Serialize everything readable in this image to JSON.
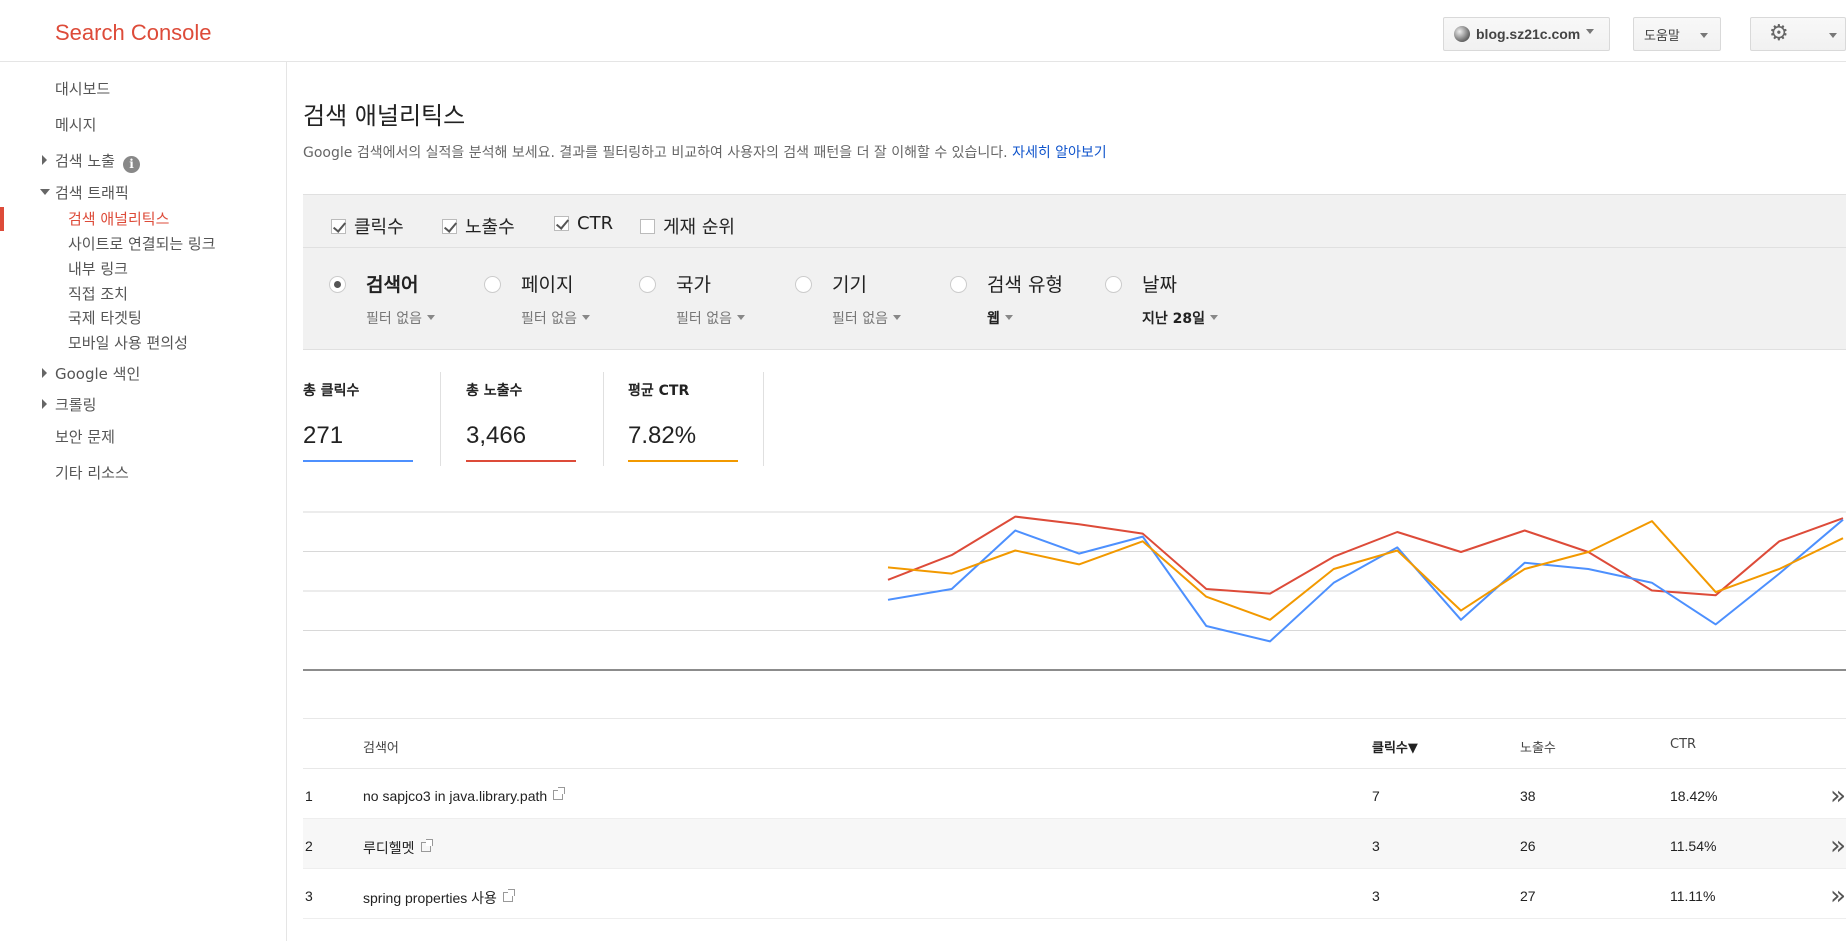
{
  "header": {
    "logo": "Search Console",
    "site": "blog.sz21c.com",
    "help": "도움말"
  },
  "sidebar": {
    "items": [
      {
        "label": "대시보드"
      },
      {
        "label": "메시지"
      },
      {
        "label": "검색 노출"
      },
      {
        "label": "검색 트래픽"
      },
      {
        "label": "Google 색인"
      },
      {
        "label": "크롤링"
      },
      {
        "label": "보안 문제"
      },
      {
        "label": "기타 리소스"
      }
    ],
    "subitems": [
      {
        "label": "검색 애널리틱스"
      },
      {
        "label": "사이트로 연결되는 링크"
      },
      {
        "label": "내부 링크"
      },
      {
        "label": "직접 조치"
      },
      {
        "label": "국제 타겟팅"
      },
      {
        "label": "모바일 사용 편의성"
      }
    ]
  },
  "page": {
    "title": "검색 애널리틱스",
    "subtitle": "Google 검색에서의 실적을 분석해 보세요. 결과를 필터링하고 비교하여 사용자의 검색 패턴을 더 잘 이해할 수 있습니다.",
    "learn_more": "자세히 알아보기"
  },
  "metrics": [
    {
      "label": "클릭수",
      "checked": true
    },
    {
      "label": "노출수",
      "checked": true
    },
    {
      "label": "CTR",
      "checked": true
    },
    {
      "label": "게재 순위",
      "checked": false
    }
  ],
  "dimensions": [
    {
      "label": "검색어",
      "filter": "필터 없음",
      "selected": true
    },
    {
      "label": "페이지",
      "filter": "필터 없음",
      "selected": false
    },
    {
      "label": "국가",
      "filter": "필터 없음",
      "selected": false
    },
    {
      "label": "기기",
      "filter": "필터 없음",
      "selected": false
    },
    {
      "label": "검색 유형",
      "filter": "웹",
      "selected": false
    },
    {
      "label": "날짜",
      "filter": "지난 28일",
      "selected": false
    }
  ],
  "totals": [
    {
      "label": "총 클릭수",
      "value": "271",
      "color": "#4d90fe"
    },
    {
      "label": "총 노출수",
      "value": "3,466",
      "color": "#dd4b39"
    },
    {
      "label": "평균 CTR",
      "value": "7.82%",
      "color": "#f29900"
    }
  ],
  "chart_data": {
    "type": "line",
    "x": [
      1,
      2,
      3,
      4,
      5,
      6,
      7,
      8,
      9,
      10,
      11,
      12,
      13,
      14,
      15
    ],
    "series": [
      {
        "color": "#dd4b39",
        "values": [
          0.56,
          0.72,
          0.97,
          0.92,
          0.86,
          0.5,
          0.47,
          0.71,
          0.87,
          0.74,
          0.88,
          0.74,
          0.49,
          0.46,
          0.81,
          0.96
        ]
      },
      {
        "color": "#4d90fe",
        "values": [
          0.43,
          0.5,
          0.88,
          0.73,
          0.84,
          0.26,
          0.16,
          0.54,
          0.77,
          0.3,
          0.67,
          0.63,
          0.54,
          0.27,
          0.6,
          0.95
        ]
      },
      {
        "color": "#f29900",
        "values": [
          0.64,
          0.6,
          0.75,
          0.66,
          0.81,
          0.45,
          0.3,
          0.63,
          0.75,
          0.36,
          0.63,
          0.74,
          0.94,
          0.48,
          0.63,
          0.83
        ]
      }
    ],
    "ylim": [
      0,
      1
    ]
  },
  "table": {
    "headers": {
      "query": "검색어",
      "clicks": "클릭수▼",
      "impressions": "노출수",
      "ctr": "CTR"
    },
    "rows": [
      {
        "rank": "1",
        "query": "no sapjco3 in java.library.path",
        "clicks": "7",
        "impressions": "38",
        "ctr": "18.42%"
      },
      {
        "rank": "2",
        "query": "루디헬멧",
        "clicks": "3",
        "impressions": "26",
        "ctr": "11.54%"
      },
      {
        "rank": "3",
        "query": "spring properties 사용",
        "clicks": "3",
        "impressions": "27",
        "ctr": "11.11%"
      }
    ],
    "expand_glyph": "»"
  }
}
